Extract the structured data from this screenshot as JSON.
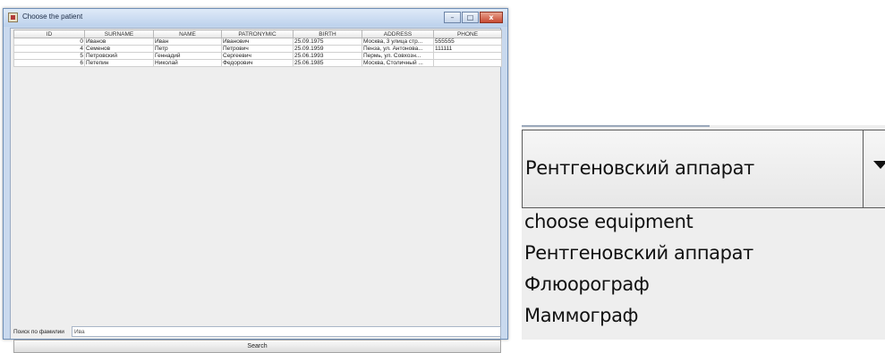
{
  "window": {
    "title": "Choose the patient",
    "buttons": {
      "minimize": "–",
      "maximize": "□",
      "close": "x"
    }
  },
  "table": {
    "columns": [
      "ID",
      "SURNAME",
      "NAME",
      "PATRONYMIC",
      "BIRTH",
      "ADDRESS",
      "PHONE"
    ],
    "rows": [
      [
        "0",
        "Иванов",
        "Иван",
        "Иванович",
        "25.09.1975",
        "Москва, 3 улица стр...",
        "555555"
      ],
      [
        "4",
        "Семенов",
        "Петр",
        "Петрович",
        "25.09.1959",
        "Пенза, ул. Антонова...",
        "111111"
      ],
      [
        "5",
        "Петровский",
        "Геннадий",
        "Сергеевич",
        "25.06.1993",
        "Пермь, ул. Совхозн...",
        ""
      ],
      [
        "6",
        "Петепин",
        "Николай",
        "Федорович",
        "25.06.1985",
        "Москва, Столичный ...",
        ""
      ]
    ]
  },
  "search": {
    "label": "Поиск по фамилии",
    "value": "Ива",
    "button_label": "Search"
  },
  "equipment_combo": {
    "selected": "Рентгеновский аппарат",
    "options": [
      "choose equipment",
      "Рентгеновский аппарат",
      "Флюорограф",
      "Маммограф"
    ]
  }
}
